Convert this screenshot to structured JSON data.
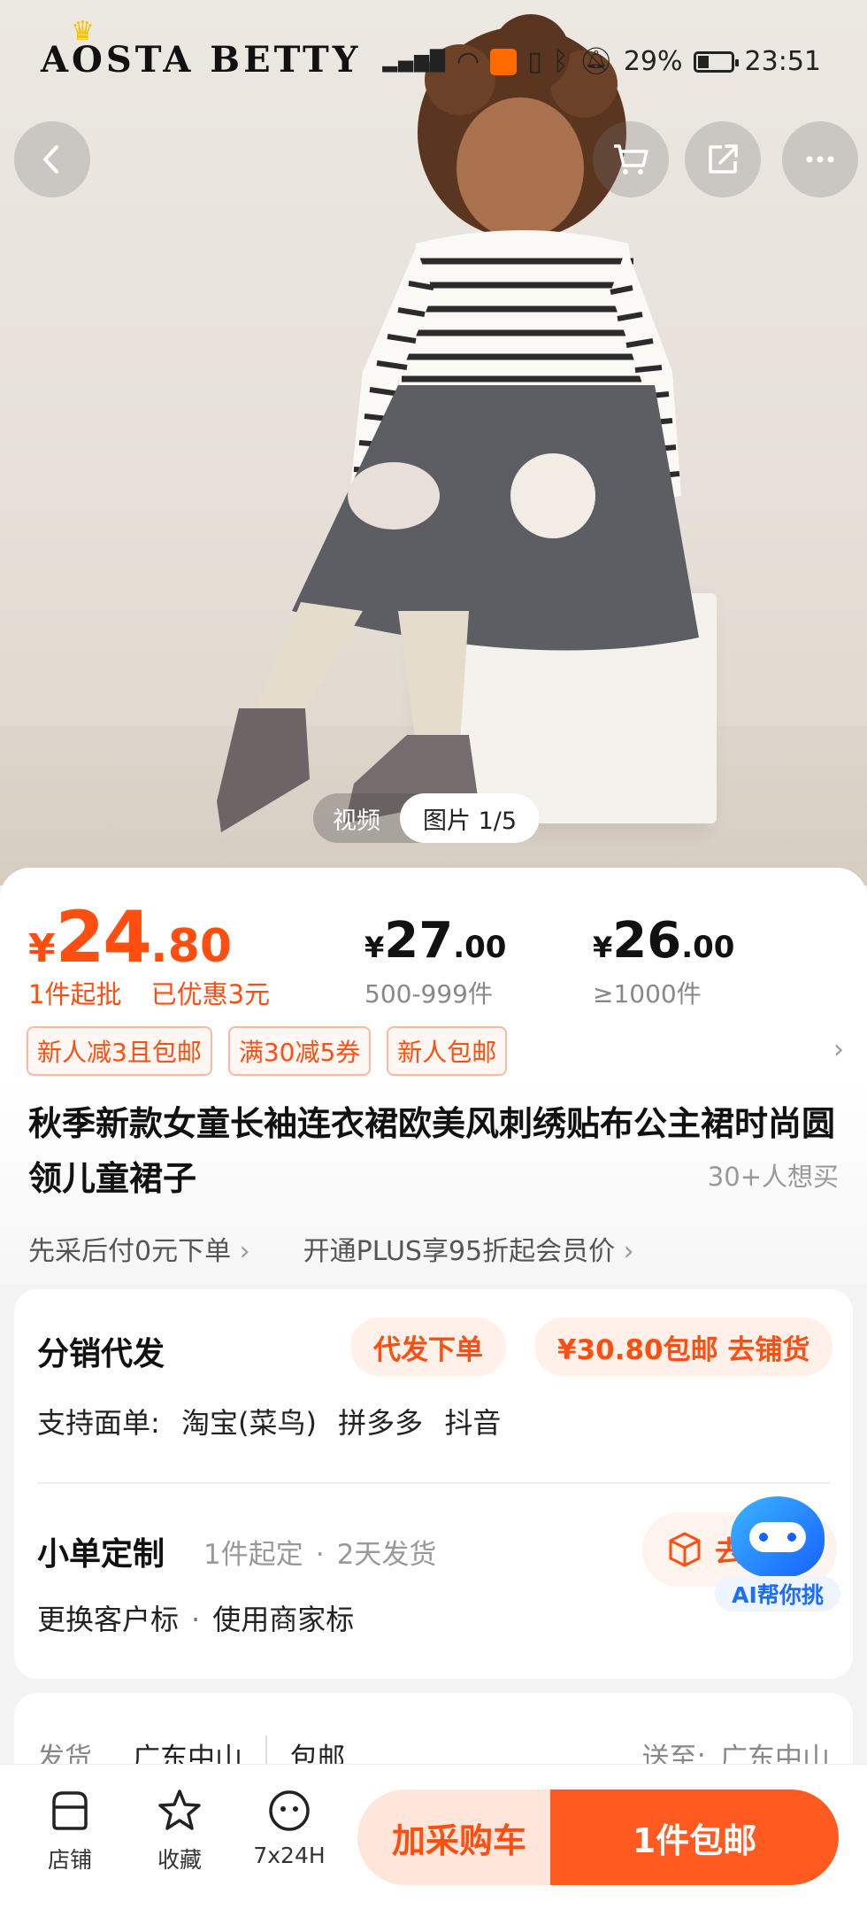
{
  "hero": {
    "brand": "AOSTA  BETTY",
    "media_tabs": {
      "video": "视频",
      "images": "图片 1/5"
    }
  },
  "status_bar": {
    "battery": "29%",
    "time": "23:51"
  },
  "price": {
    "currency": "¥",
    "main_int": "24",
    "main_dec": ".80",
    "min_order": "1件起批",
    "discount": "已优惠3元",
    "tiers": [
      {
        "currency": "¥",
        "int": "27",
        "dec": ".00",
        "qty": "500-999件"
      },
      {
        "currency": "¥",
        "int": "26",
        "dec": ".00",
        "qty": "≥1000件"
      }
    ]
  },
  "coupons": [
    "新人减3且包邮",
    "满30减5券",
    "新人包邮"
  ],
  "product": {
    "title": "秋季新款女童长袖连衣裙欧美风刺绣贴布公主裙时尚圆领儿童裙子",
    "want_count": "30+人想买"
  },
  "links": [
    "先采后付0元下单",
    "开通PLUS享95折起会员价"
  ],
  "distribution": {
    "title": "分销代发",
    "dropship_button": "代发下单",
    "stock_button": "¥30.80包邮 去铺货",
    "support_label": "支持面单:",
    "platforms": [
      "淘宝(菜鸟)",
      "拼多多",
      "抖音"
    ],
    "custom_title": "小单定制",
    "custom_meta": [
      "1件起定",
      "2天发货"
    ],
    "custom_options": [
      "更换客户标",
      "使用商家标"
    ],
    "custom_button": "去"
  },
  "ai_assistant": {
    "label": "AI帮你挑"
  },
  "shipping": {
    "label": "发货",
    "from": "广东中山",
    "free": "包邮",
    "dest_label": "送至:",
    "dest": "广东中山"
  },
  "bottom_bar": {
    "shop": "店铺",
    "favorite": "收藏",
    "service": "7x24H",
    "add_to_cart": "加采购车",
    "buy": "1件包邮"
  },
  "colors": {
    "accent": "#ff4e10",
    "buy": "#ff5a1f",
    "cart_bg": "#ffe5da"
  }
}
